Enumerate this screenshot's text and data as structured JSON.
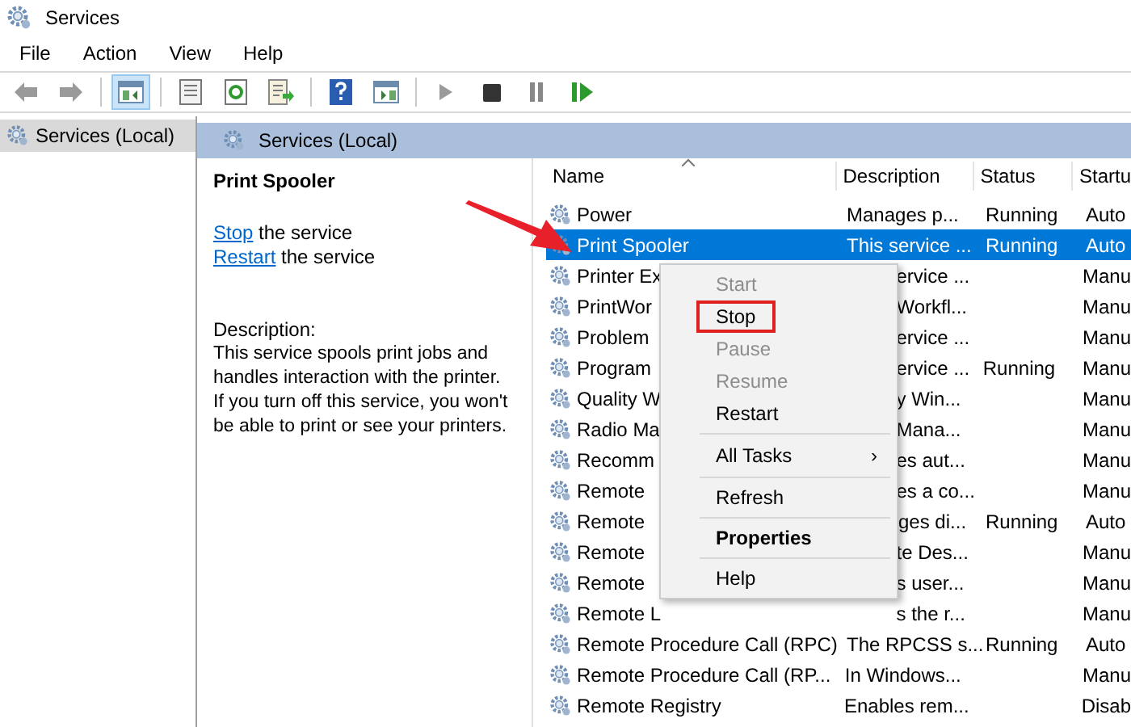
{
  "window": {
    "title": "Services"
  },
  "menu_bar": [
    "File",
    "Action",
    "View",
    "Help"
  ],
  "toolbar": [
    {
      "kind": "back",
      "selected": false
    },
    {
      "kind": "forward",
      "selected": false
    },
    {
      "kind": "sep"
    },
    {
      "kind": "tree",
      "selected": true
    },
    {
      "kind": "sep"
    },
    {
      "kind": "properties",
      "selected": false
    },
    {
      "kind": "refresh",
      "selected": false
    },
    {
      "kind": "export",
      "selected": false
    },
    {
      "kind": "sep"
    },
    {
      "kind": "help",
      "selected": false
    },
    {
      "kind": "view",
      "selected": false
    },
    {
      "kind": "sep"
    },
    {
      "kind": "play",
      "selected": false
    },
    {
      "kind": "stop",
      "selected": false
    },
    {
      "kind": "pause",
      "selected": false
    },
    {
      "kind": "resume",
      "selected": false
    }
  ],
  "tree": [
    {
      "label": "Services (Local)",
      "selected": true
    }
  ],
  "pane_header": "Services (Local)",
  "details": {
    "title": "Print Spooler",
    "actions": [
      {
        "link": "Stop",
        "rest": " the service"
      },
      {
        "link": "Restart",
        "rest": " the service"
      }
    ],
    "description_label": "Description:",
    "description": "This service spools print jobs and handles interaction with the printer. If you turn off this service, you won't be able to print or see your printers."
  },
  "columns": [
    "Name",
    "Description",
    "Status",
    "Startu"
  ],
  "rows": [
    {
      "name": "Power",
      "description": "Manages p...",
      "status": "Running",
      "startup": "Auto",
      "selected": false
    },
    {
      "name": "Print Spooler",
      "description": "This service ...",
      "status": "Running",
      "startup": "Auto",
      "selected": true
    },
    {
      "name": "Printer Ex",
      "description": "ervice ...",
      "startup": "Manu",
      "selected": false
    },
    {
      "name": "PrintWor",
      "description": "Workfl...",
      "startup": "Manu",
      "selected": false
    },
    {
      "name": "Problem",
      "description": "ervice ...",
      "startup": "Manu",
      "selected": false
    },
    {
      "name": "Program",
      "description": "ervice ...",
      "status": "Running",
      "startup": "Manu",
      "selected": false
    },
    {
      "name": "Quality W",
      "description": "y Win...",
      "startup": "Manu",
      "selected": false
    },
    {
      "name": "Radio Ma",
      "description": "Mana...",
      "startup": "Manu",
      "selected": false
    },
    {
      "name": "Recomm",
      "description": "es aut...",
      "startup": "Manu",
      "selected": false
    },
    {
      "name": "Remote",
      "description": "es a co...",
      "startup": "Manu",
      "selected": false
    },
    {
      "name": "Remote",
      "description": "ges di...",
      "status": "Running",
      "startup": "Auto",
      "selected": false
    },
    {
      "name": "Remote",
      "description": "te Des...",
      "startup": "Manu",
      "selected": false
    },
    {
      "name": "Remote",
      "description": "s user...",
      "startup": "Manu",
      "selected": false
    },
    {
      "name": "Remote L",
      "description": "s the r...",
      "startup": "Manu",
      "selected": false
    },
    {
      "name": "Remote Procedure Call (RPC)",
      "description": "The RPCSS s...",
      "status": "Running",
      "startup": "Auto",
      "selected": false
    },
    {
      "name": "Remote Procedure Call (RP...",
      "description": "In Windows...",
      "startup": "Manu",
      "selected": false
    },
    {
      "name": "Remote Registry",
      "description": "Enables rem...",
      "startup": "Disab",
      "selected": false
    }
  ],
  "context_menu": [
    {
      "kind": "item",
      "label": "Start",
      "disabled": true,
      "highlighted": false,
      "bold": false
    },
    {
      "kind": "item",
      "label": "Stop",
      "disabled": false,
      "highlighted": true,
      "bold": false
    },
    {
      "kind": "item",
      "label": "Pause",
      "disabled": true,
      "highlighted": false,
      "bold": false
    },
    {
      "kind": "item",
      "label": "Resume",
      "disabled": true,
      "highlighted": false,
      "bold": false
    },
    {
      "kind": "item",
      "label": "Restart",
      "disabled": false,
      "highlighted": false,
      "bold": false
    },
    {
      "kind": "separator"
    },
    {
      "kind": "submenu",
      "label": "All Tasks",
      "arrow": "›"
    },
    {
      "kind": "separator"
    },
    {
      "kind": "item",
      "label": "Refresh",
      "disabled": false,
      "highlighted": false,
      "bold": false
    },
    {
      "kind": "separator"
    },
    {
      "kind": "item",
      "label": "Properties",
      "disabled": false,
      "highlighted": false,
      "bold": true
    },
    {
      "kind": "separator"
    },
    {
      "kind": "item",
      "label": "Help",
      "disabled": false,
      "highlighted": false,
      "bold": false
    }
  ]
}
